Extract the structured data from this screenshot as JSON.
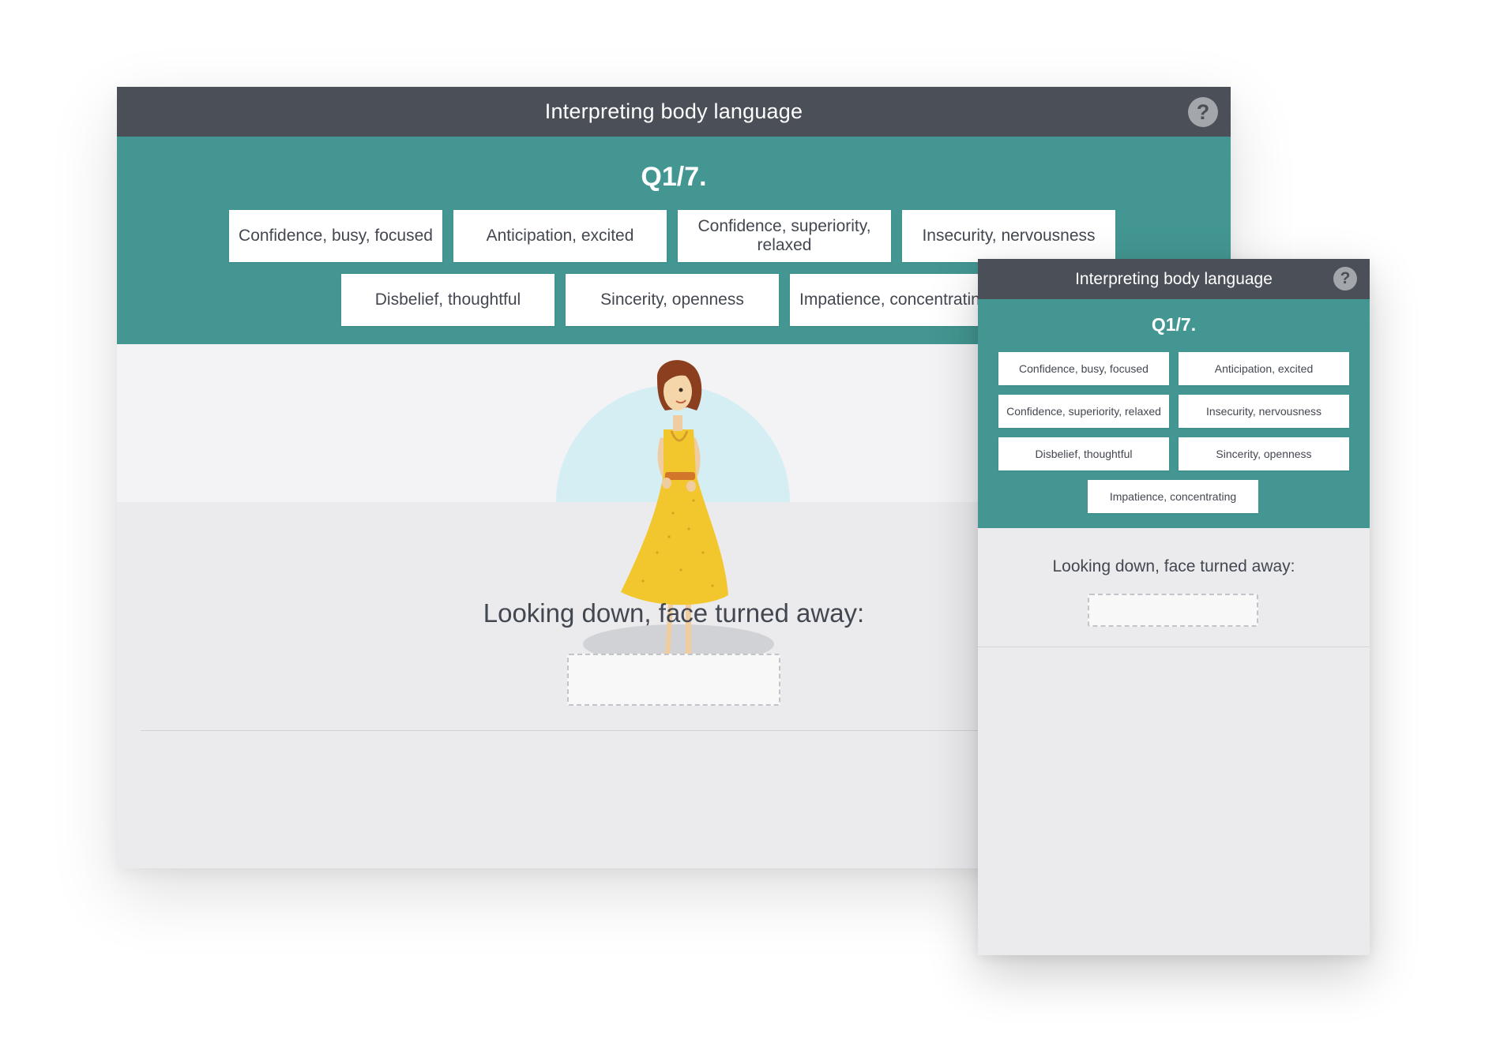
{
  "app": {
    "title": "Interpreting body language",
    "help_icon": "help-circle-icon",
    "help_glyph": "?"
  },
  "question": {
    "number": "Q1/7.",
    "prompt": "Looking down, face turned away:"
  },
  "desktop": {
    "options": [
      "Confidence, busy, focused",
      "Anticipation, excited",
      "Confidence, superiority, relaxed",
      "Insecurity, nervousness",
      "Disbelief, thoughtful",
      "Sincerity, openness",
      "Impatience, concentrating"
    ]
  },
  "mobile": {
    "options": [
      "Confidence, busy, focused",
      "Anticipation, excited",
      "Confidence, superiority, relaxed",
      "Insecurity, nervousness",
      "Disbelief, thoughtful",
      "Sincerity, openness",
      "Impatience, concentrating"
    ]
  },
  "illustration": {
    "name": "woman-in-yellow-dress-illustration"
  },
  "colors": {
    "titlebar": "#4a4f58",
    "teal": "#439692",
    "background": "#ebebee",
    "chip_text": "#434750"
  }
}
